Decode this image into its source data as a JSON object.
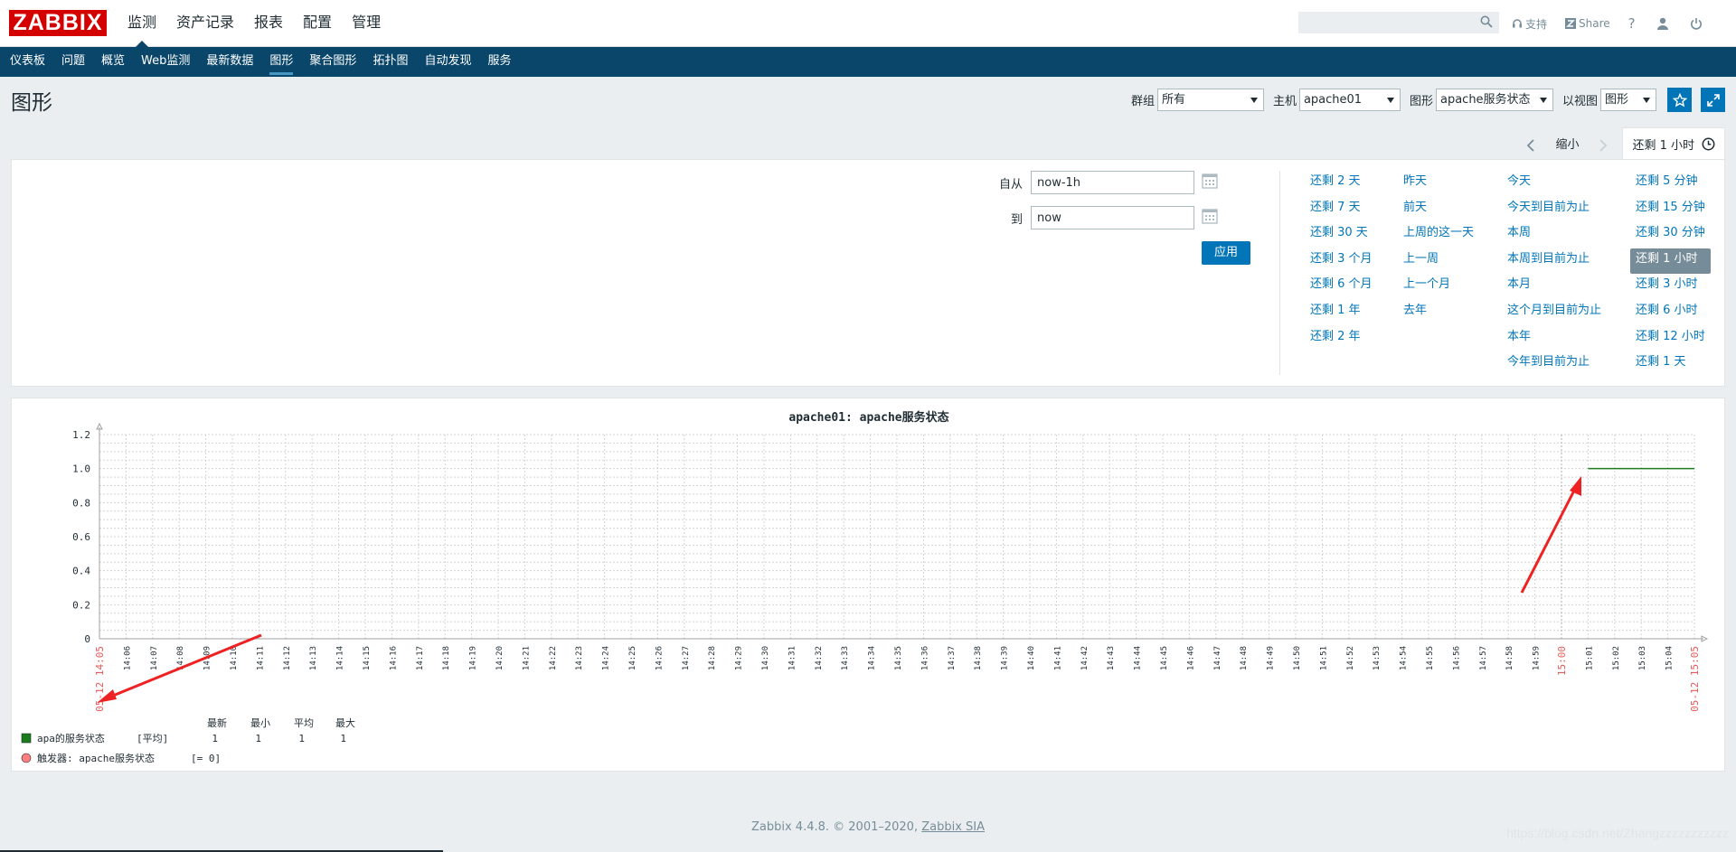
{
  "header": {
    "logo_text": "ZABBIX",
    "menu": [
      {
        "label": "监测"
      },
      {
        "label": "资产记录"
      },
      {
        "label": "报表"
      },
      {
        "label": "配置"
      },
      {
        "label": "管理"
      }
    ],
    "search_placeholder": "",
    "support_label": "支持",
    "share_label": "Share",
    "help_label": "?"
  },
  "submenu": [
    {
      "label": "仪表板"
    },
    {
      "label": "问题"
    },
    {
      "label": "概览"
    },
    {
      "label": "Web监测"
    },
    {
      "label": "最新数据"
    },
    {
      "label": "图形"
    },
    {
      "label": "聚合图形"
    },
    {
      "label": "拓扑图"
    },
    {
      "label": "自动发现"
    },
    {
      "label": "服务"
    }
  ],
  "page": {
    "title": "图形",
    "filters": {
      "group_label": "群组",
      "group_value": "所有",
      "host_label": "主机",
      "host_value": "apache01",
      "graph_label": "图形",
      "graph_value": "apache服务状态",
      "view_label": "以视图",
      "view_value": "图形"
    }
  },
  "timenav": {
    "zoom_out": "缩小",
    "active_tab": "还剩 1 小时"
  },
  "timefilter": {
    "from_label": "自从",
    "from_value": "now-1h",
    "to_label": "到",
    "to_value": "now",
    "apply_label": "应用",
    "quick_cols": [
      [
        "还剩 2 天",
        "还剩 7 天",
        "还剩 30 天",
        "还剩 3 个月",
        "还剩 6 个月",
        "还剩 1 年",
        "还剩 2 年"
      ],
      [
        "昨天",
        "前天",
        "上周的这一天",
        "上一周",
        "上一个月",
        "去年"
      ],
      [
        "今天",
        "今天到目前为止",
        "本周",
        "本周到目前为止",
        "本月",
        "这个月到目前为止",
        "本年",
        "今年到目前为止"
      ],
      [
        "还剩 5 分钟",
        "还剩 15 分钟",
        "还剩 30 分钟",
        "还剩 1 小时",
        "还剩 3 小时",
        "还剩 6 小时",
        "还剩 12 小时",
        "还剩 1 天"
      ]
    ],
    "selected_quick": "还剩 1 小时"
  },
  "chart_data": {
    "type": "line",
    "title": "apache01: apache服务状态",
    "ylim": [
      0,
      1.2
    ],
    "y_ticks": [
      "0",
      "0.2",
      "0.4",
      "0.6",
      "0.8",
      "1.0",
      "1.2"
    ],
    "x_start_label": "05-12 14:05",
    "x_end_label": "05-12 15:05",
    "x_major_label": "15:00",
    "x_ticks": [
      "14:06",
      "14:07",
      "14:08",
      "14:09",
      "14:10",
      "14:11",
      "14:12",
      "14:13",
      "14:14",
      "14:15",
      "14:16",
      "14:17",
      "14:18",
      "14:19",
      "14:20",
      "14:21",
      "14:22",
      "14:23",
      "14:24",
      "14:25",
      "14:26",
      "14:27",
      "14:28",
      "14:29",
      "14:30",
      "14:31",
      "14:32",
      "14:33",
      "14:34",
      "14:35",
      "14:36",
      "14:37",
      "14:38",
      "14:39",
      "14:40",
      "14:41",
      "14:42",
      "14:43",
      "14:44",
      "14:45",
      "14:46",
      "14:47",
      "14:48",
      "14:49",
      "14:50",
      "14:51",
      "14:52",
      "14:53",
      "14:54",
      "14:55",
      "14:56",
      "14:57",
      "14:58",
      "14:59",
      "15:00",
      "15:01",
      "15:02",
      "15:03",
      "15:04",
      "15:05"
    ],
    "series": [
      {
        "name": "apa的服务状态",
        "color": "#1a7c1a",
        "x": [
          "15:01",
          "15:05"
        ],
        "values": [
          1,
          1
        ]
      }
    ],
    "legend": {
      "headers": [
        "最新",
        "最小",
        "平均",
        "最大"
      ],
      "rows": [
        {
          "color": "#1a7c1a",
          "label": "apa的服务状态",
          "func": "[平均]",
          "values": [
            "1",
            "1",
            "1",
            "1"
          ]
        }
      ],
      "trigger": {
        "color": "#ff7f7f",
        "label": "触发器: apache服务状态",
        "cond": "[= 0]"
      }
    }
  },
  "footer": {
    "text": "Zabbix 4.4.8. © 2001–2020, ",
    "link": "Zabbix SIA"
  },
  "watermark": "https://blog.csdn.net/Zhangzzzzzzzzzzz"
}
